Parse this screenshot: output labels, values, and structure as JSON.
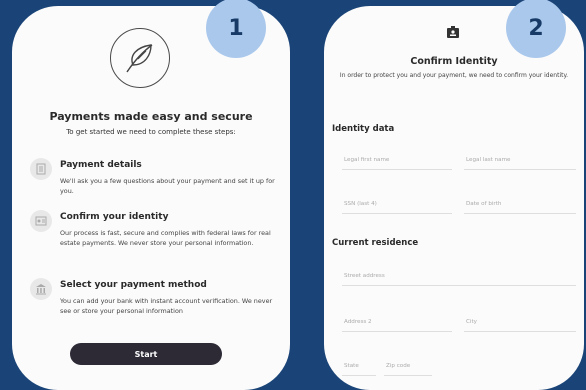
{
  "panel1": {
    "badge": "1",
    "title": "Payments made easy and secure",
    "subtitle": "To get started we need to complete these steps:",
    "steps": [
      {
        "title": "Payment details",
        "desc": "We'll ask you a few questions about your payment and set it up for you.",
        "icon": "document-icon"
      },
      {
        "title": "Confirm your identity",
        "desc": "Our process is fast, secure and complies with federal laws for real estate payments. We never store your personal information.",
        "icon": "id-card-icon"
      },
      {
        "title": "Select your payment method",
        "desc": "You can add your bank with instant account verification. We never see or store your personal information",
        "icon": "bank-icon"
      }
    ],
    "start_label": "Start"
  },
  "panel2": {
    "badge": "2",
    "title": "Confirm Identity",
    "desc": "In order to protect you and your payment, we need to confirm your identity.",
    "identity_section": "Identity data",
    "residence_section": "Current residence",
    "fields": {
      "first_name": "Legal first name",
      "last_name": "Legal last name",
      "ssn": "SSN (last 4)",
      "dob": "Date of birth",
      "street": "Street address",
      "address2": "Address 2",
      "city": "City",
      "state": "State",
      "zip": "Zip code"
    }
  },
  "colors": {
    "background": "#1a4478",
    "badge": "#aac8ec",
    "button": "#2d2a36"
  }
}
